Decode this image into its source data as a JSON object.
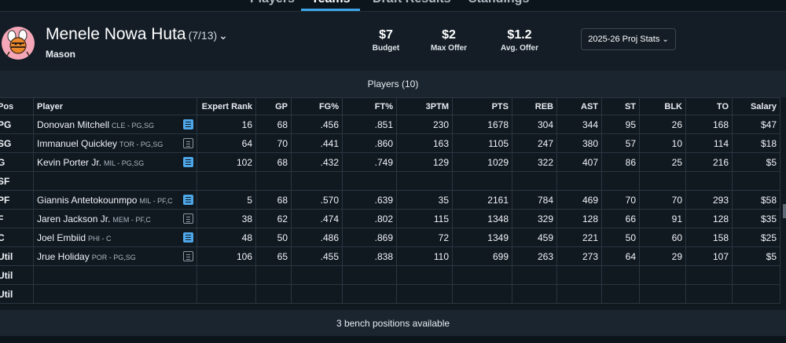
{
  "nav": {
    "tabs": [
      {
        "label": "Players"
      },
      {
        "label": "Teams"
      },
      {
        "label": "Draft Results"
      },
      {
        "label": "Standings"
      }
    ],
    "active_index": 1
  },
  "team": {
    "name": "Menele Nowa Huta",
    "record": "(7/13)",
    "owner": "Mason"
  },
  "stats": [
    {
      "value": "$7",
      "label": "Budget"
    },
    {
      "value": "$2",
      "label": "Max Offer"
    },
    {
      "value": "$1.2",
      "label": "Avg. Offer"
    }
  ],
  "proj_select": {
    "label": "2025-26 Proj Stats"
  },
  "players_header": "Players (10)",
  "columns": [
    "Pos",
    "Player",
    "Expert Rank",
    "GP",
    "FG%",
    "FT%",
    "3PTM",
    "PTS",
    "REB",
    "AST",
    "ST",
    "BLK",
    "TO",
    "Salary"
  ],
  "rows": [
    {
      "pos": "PG",
      "name": "Donovan Mitchell",
      "meta": "CLE - PG,SG",
      "note": "filled",
      "rank": "16",
      "gp": "68",
      "fg": ".456",
      "ft": ".851",
      "tpm": "230",
      "pts": "1678",
      "reb": "304",
      "ast": "344",
      "st": "95",
      "blk": "26",
      "to": "168",
      "salary": "$47"
    },
    {
      "pos": "SG",
      "name": "Immanuel Quickley",
      "meta": "TOR - PG,SG",
      "note": "outline",
      "rank": "64",
      "gp": "70",
      "fg": ".441",
      "ft": ".860",
      "tpm": "163",
      "pts": "1105",
      "reb": "247",
      "ast": "380",
      "st": "57",
      "blk": "10",
      "to": "114",
      "salary": "$18"
    },
    {
      "pos": "G",
      "name": "Kevin Porter Jr.",
      "meta": "MIL - PG,SG",
      "note": "filled",
      "rank": "102",
      "gp": "68",
      "fg": ".432",
      "ft": ".749",
      "tpm": "129",
      "pts": "1029",
      "reb": "322",
      "ast": "407",
      "st": "86",
      "blk": "25",
      "to": "216",
      "salary": "$5"
    },
    {
      "pos": "SF",
      "name": "",
      "meta": "",
      "note": "",
      "rank": "",
      "gp": "",
      "fg": "",
      "ft": "",
      "tpm": "",
      "pts": "",
      "reb": "",
      "ast": "",
      "st": "",
      "blk": "",
      "to": "",
      "salary": ""
    },
    {
      "pos": "PF",
      "name": "Giannis Antetokounmpo",
      "meta": "MIL - PF,C",
      "note": "filled",
      "rank": "5",
      "gp": "68",
      "fg": ".570",
      "ft": ".639",
      "tpm": "35",
      "pts": "2161",
      "reb": "784",
      "ast": "469",
      "st": "70",
      "blk": "70",
      "to": "293",
      "salary": "$58"
    },
    {
      "pos": "F",
      "name": "Jaren Jackson Jr.",
      "meta": "MEM - PF,C",
      "note": "outline",
      "rank": "38",
      "gp": "62",
      "fg": ".474",
      "ft": ".802",
      "tpm": "115",
      "pts": "1348",
      "reb": "329",
      "ast": "128",
      "st": "66",
      "blk": "91",
      "to": "128",
      "salary": "$35"
    },
    {
      "pos": "C",
      "name": "Joel Embiid",
      "meta": "PHI - C",
      "note": "filled",
      "rank": "48",
      "gp": "50",
      "fg": ".486",
      "ft": ".869",
      "tpm": "72",
      "pts": "1349",
      "reb": "459",
      "ast": "221",
      "st": "50",
      "blk": "60",
      "to": "158",
      "salary": "$25"
    },
    {
      "pos": "Util",
      "name": "Jrue Holiday",
      "meta": "POR - PG,SG",
      "note": "outline",
      "rank": "106",
      "gp": "65",
      "fg": ".455",
      "ft": ".838",
      "tpm": "110",
      "pts": "699",
      "reb": "263",
      "ast": "273",
      "st": "64",
      "blk": "29",
      "to": "107",
      "salary": "$5"
    },
    {
      "pos": "Util",
      "name": "",
      "meta": "",
      "note": "",
      "rank": "",
      "gp": "",
      "fg": "",
      "ft": "",
      "tpm": "",
      "pts": "",
      "reb": "",
      "ast": "",
      "st": "",
      "blk": "",
      "to": "",
      "salary": ""
    },
    {
      "pos": "Util",
      "name": "",
      "meta": "",
      "note": "",
      "rank": "",
      "gp": "",
      "fg": "",
      "ft": "",
      "tpm": "",
      "pts": "",
      "reb": "",
      "ast": "",
      "st": "",
      "blk": "",
      "to": "",
      "salary": ""
    }
  ],
  "bench_text": "3 bench positions available",
  "colors": {
    "accent": "#3da5e8",
    "background": "#101820",
    "note_filled": "#4ea7e8"
  }
}
